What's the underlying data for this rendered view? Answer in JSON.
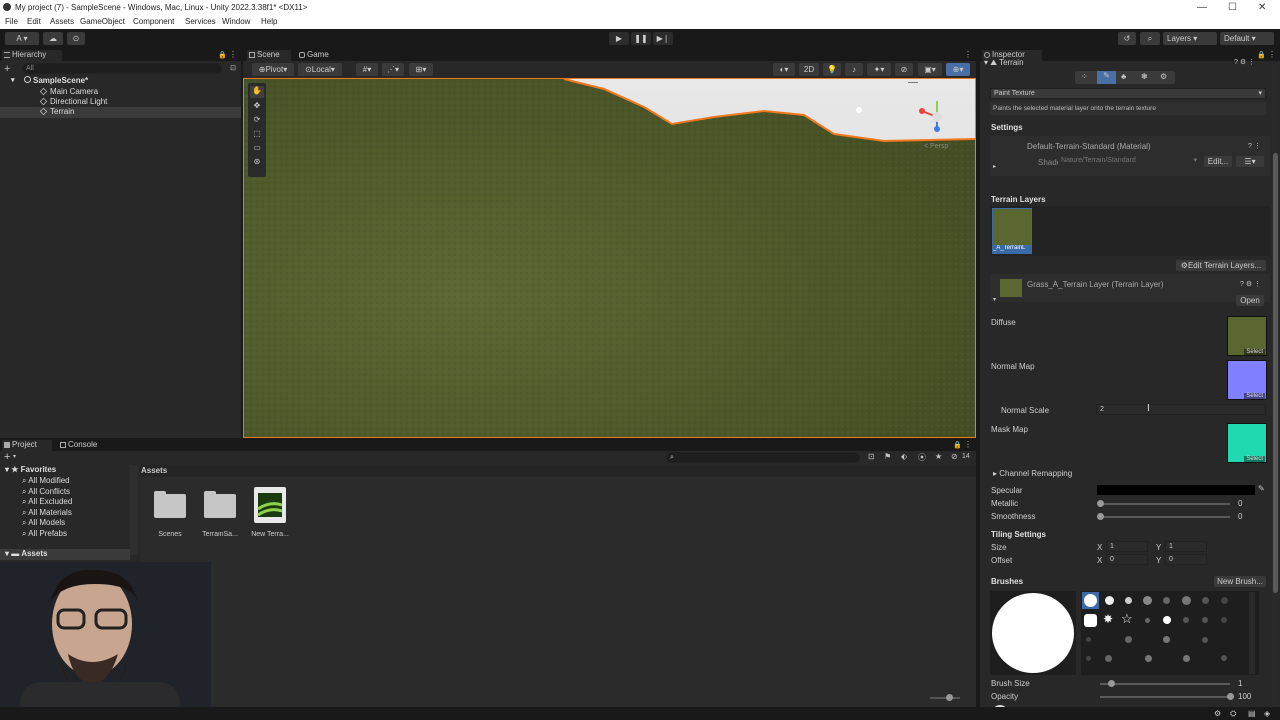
{
  "window": {
    "title": "My project (7) - SampleScene - Windows, Mac, Linux - Unity 2022.3.38f1* <DX11>",
    "minimize": "—",
    "maximize": "☐",
    "close": "✕"
  },
  "menu": [
    "File",
    "Edit",
    "Assets",
    "GameObject",
    "Component",
    "Services",
    "Window",
    "Help"
  ],
  "toolbar": {
    "account": "A ▾",
    "layers": "Layers",
    "layout": "Default"
  },
  "hierarchy": {
    "tab": "Hierarchy",
    "search_placeholder": "All",
    "scene": "SampleScene*",
    "items": [
      "Main Camera",
      "Directional Light",
      "Terrain"
    ]
  },
  "scene_view": {
    "tabs": [
      "Scene",
      "Game"
    ],
    "pivot": "Pivot",
    "local": "Local",
    "mode_2d": "2D",
    "persp": "< Persp"
  },
  "project": {
    "tabs": [
      "Project",
      "Console"
    ],
    "favorites_label": "Favorites",
    "favorites": [
      "All Modified",
      "All Conflicts",
      "All Excluded",
      "All Materials",
      "All Models",
      "All Prefabs"
    ],
    "assets_root": "Assets",
    "breadcrumb": "Assets",
    "hidden_count": "14",
    "assets": [
      {
        "name": "Scenes",
        "kind": "folder"
      },
      {
        "name": "TerrainSa...",
        "kind": "folder"
      },
      {
        "name": "New Terra...",
        "kind": "terrain"
      }
    ]
  },
  "inspector": {
    "tab": "Inspector",
    "component": "Terrain",
    "tool_dropdown": "Paint Texture",
    "tool_help": "Paints the selected material layer onto the terrain texture",
    "settings_label": "Settings",
    "material_name": "Default-Terrain-Standard (Material)",
    "shader_label": "Shader",
    "shader_value": "Nature/Terrain/Standard",
    "edit_button": "Edit...",
    "terrain_layers_label": "Terrain Layers",
    "layer_thumb_label": "_A_TerrainL",
    "edit_layers_button": "Edit Terrain Layers...",
    "layer_name": "Grass_A_Terrain Layer (Terrain Layer)",
    "open_button": "Open",
    "diffuse_label": "Diffuse",
    "normal_map_label": "Normal Map",
    "normal_scale_label": "Normal Scale",
    "normal_scale_value": "2",
    "mask_map_label": "Mask Map",
    "select_label": "Select",
    "channel_remapping": "Channel Remapping",
    "specular_label": "Specular",
    "metallic_label": "Metallic",
    "metallic_value": "0",
    "smoothness_label": "Smoothness",
    "smoothness_value": "0",
    "tiling_label": "Tiling Settings",
    "size_label": "Size",
    "size_x": "1",
    "size_y": "1",
    "offset_label": "Offset",
    "offset_x": "0",
    "offset_y": "0",
    "x_label": "X",
    "y_label": "Y",
    "brushes_label": "Brushes",
    "new_brush_button": "New Brush...",
    "brush_size_label": "Brush Size",
    "brush_size_value": "1",
    "opacity_label": "Opacity",
    "opacity_value": "100",
    "metallic_level": 0,
    "smoothness_level": 0,
    "opacity_level": 1.0
  },
  "colors": {
    "grass": "#4f5a2c",
    "normal_map": "#7f7fff",
    "mask_map": "#1fd9b0",
    "selection_outline": "#f0781e"
  }
}
